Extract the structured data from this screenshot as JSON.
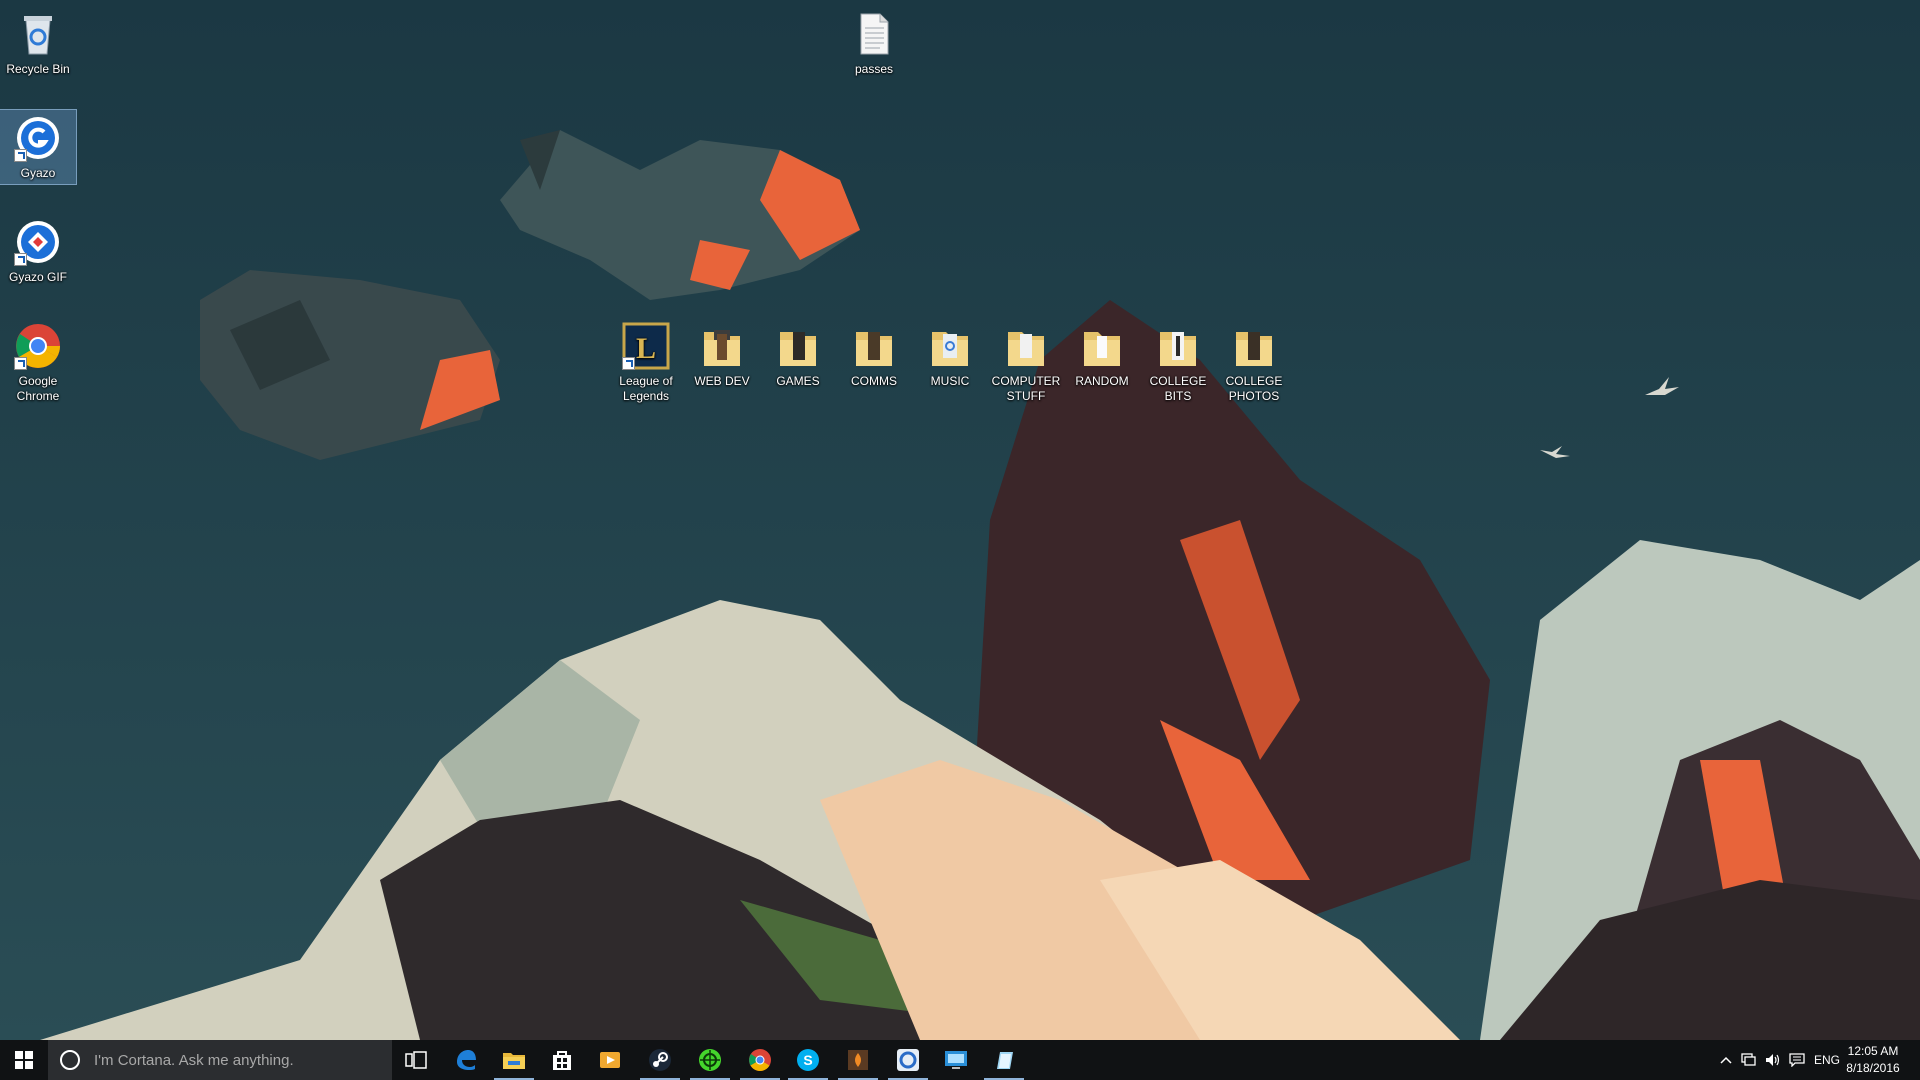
{
  "desktop": {
    "left_icons": [
      {
        "label": "Recycle Bin",
        "icon": "recycle-bin-icon"
      },
      {
        "label": "Gyazo",
        "icon": "gyazo-icon"
      },
      {
        "label": "Gyazo GIF",
        "icon": "gyazo-gif-icon"
      },
      {
        "label": "Google Chrome",
        "icon": "chrome-icon"
      }
    ],
    "top_icon": {
      "label": "passes",
      "icon": "text-file-icon"
    },
    "row_icons": [
      {
        "label": "League of Legends",
        "icon": "league-of-legends-icon"
      },
      {
        "label": "WEB DEV",
        "icon": "folder-icon"
      },
      {
        "label": "GAMES",
        "icon": "folder-icon"
      },
      {
        "label": "COMMS",
        "icon": "folder-icon"
      },
      {
        "label": "MUSIC",
        "icon": "folder-icon"
      },
      {
        "label": "COMPUTER STUFF",
        "icon": "folder-icon"
      },
      {
        "label": "RANDOM",
        "icon": "folder-icon"
      },
      {
        "label": "COLLEGE BITS",
        "icon": "folder-icon"
      },
      {
        "label": "COLLEGE PHOTOS",
        "icon": "folder-icon"
      }
    ]
  },
  "taskbar": {
    "search_placeholder": "I'm Cortana. Ask me anything.",
    "pinned": [
      "task-view-icon",
      "edge-icon",
      "file-explorer-icon",
      "store-icon",
      "media-player-icon",
      "steam-icon",
      "razer-icon",
      "chrome-icon",
      "skype-icon",
      "game-app-icon",
      "uplay-icon",
      "remote-desktop-icon",
      "notepad-icon"
    ],
    "tray": {
      "language": "ENG",
      "time": "12:05 AM",
      "date": "8/18/2016"
    }
  },
  "colors": {
    "sky": "#1f3f4a",
    "accent_orange": "#e8643a",
    "taskbar": "#101214"
  }
}
